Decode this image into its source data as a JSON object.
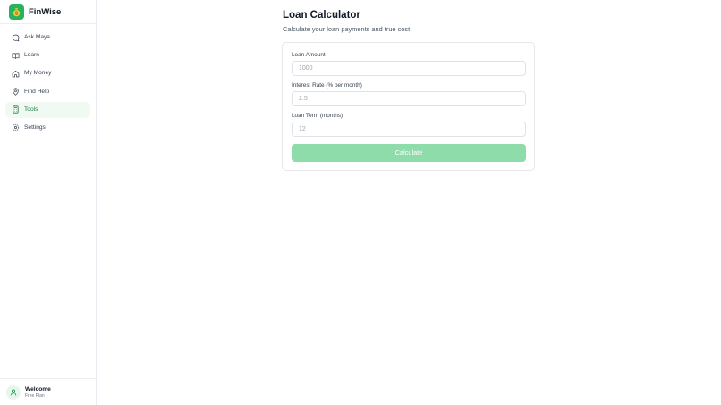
{
  "brand": {
    "name": "FinWise",
    "logo_icon": "money-bag-icon",
    "accent": "#27b35b"
  },
  "sidebar": {
    "items": [
      {
        "label": "Ask Maya",
        "icon": "chat-bubble-icon",
        "active": false
      },
      {
        "label": "Learn",
        "icon": "book-icon",
        "active": false
      },
      {
        "label": "My Money",
        "icon": "home-icon",
        "active": false
      },
      {
        "label": "Find Help",
        "icon": "map-pin-icon",
        "active": false
      },
      {
        "label": "Tools",
        "icon": "calculator-icon",
        "active": true
      },
      {
        "label": "Settings",
        "icon": "gear-icon",
        "active": false
      }
    ]
  },
  "user": {
    "name": "Welcome",
    "plan": "Free Plan",
    "icon": "user-icon"
  },
  "main": {
    "title": "Loan Calculator",
    "subtitle": "Calculate your loan payments and true cost"
  },
  "form": {
    "loan_amount": {
      "label": "Loan Amount",
      "placeholder": "1000",
      "value": ""
    },
    "interest_rate": {
      "label": "Interest Rate (% per month)",
      "placeholder": "2.5",
      "value": ""
    },
    "loan_term": {
      "label": "Loan Term (months)",
      "placeholder": "12",
      "value": ""
    },
    "submit_label": "Calculate",
    "submit_color": "#8fdcab"
  }
}
